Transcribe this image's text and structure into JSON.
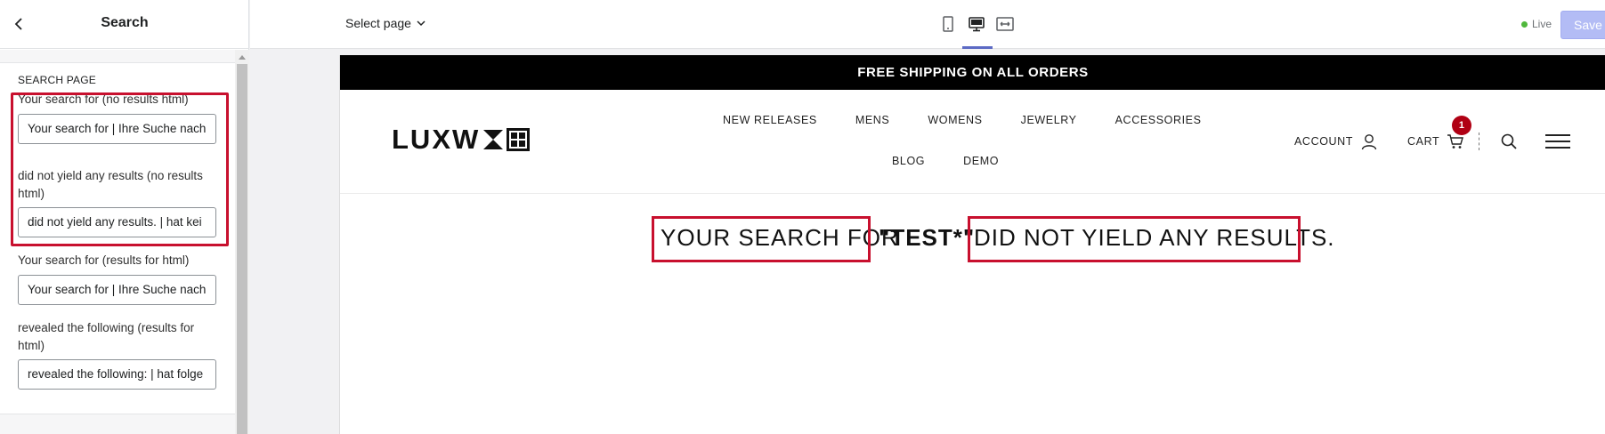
{
  "sidebar": {
    "title": "Search",
    "section_title": "SEARCH PAGE",
    "fields": [
      {
        "label": "Your search for (no results html)",
        "value": "Your search for | Ihre Suche nach"
      },
      {
        "label": "did not yield any results (no results html)",
        "value": "did not yield any results. | hat kei"
      },
      {
        "label": "Your search for (results for html)",
        "value": "Your search for | Ihre Suche nach"
      },
      {
        "label": "revealed the following (results for html)",
        "value": "revealed the following: | hat folge"
      }
    ]
  },
  "topbar": {
    "select_page": "Select page",
    "device_icons": [
      "mobile-icon",
      "desktop-icon",
      "fullwidth-icon"
    ],
    "active_device": "desktop",
    "live_label": "Live",
    "save_label": "Save"
  },
  "preview": {
    "announcement": "FREE SHIPPING ON ALL ORDERS",
    "logo_text": "LUXW",
    "nav": [
      "NEW RELEASES",
      "MENS",
      "WOMENS",
      "JEWELRY",
      "ACCESSORIES",
      "BLOG",
      "DEMO"
    ],
    "account_label": "ACCOUNT",
    "cart_label": "CART",
    "cart_count": "1",
    "search_result": {
      "prefix": "YOUR SEARCH FOR",
      "query": "\"TEST*\"",
      "suffix": "DID NOT YIELD ANY RESULTS."
    }
  },
  "colors": {
    "highlight": "#c8102e",
    "accent": "#5c6ac4",
    "save_disabled": "#b3bcf5",
    "live_dot": "#50b83c",
    "cart_badge": "#b00014"
  }
}
